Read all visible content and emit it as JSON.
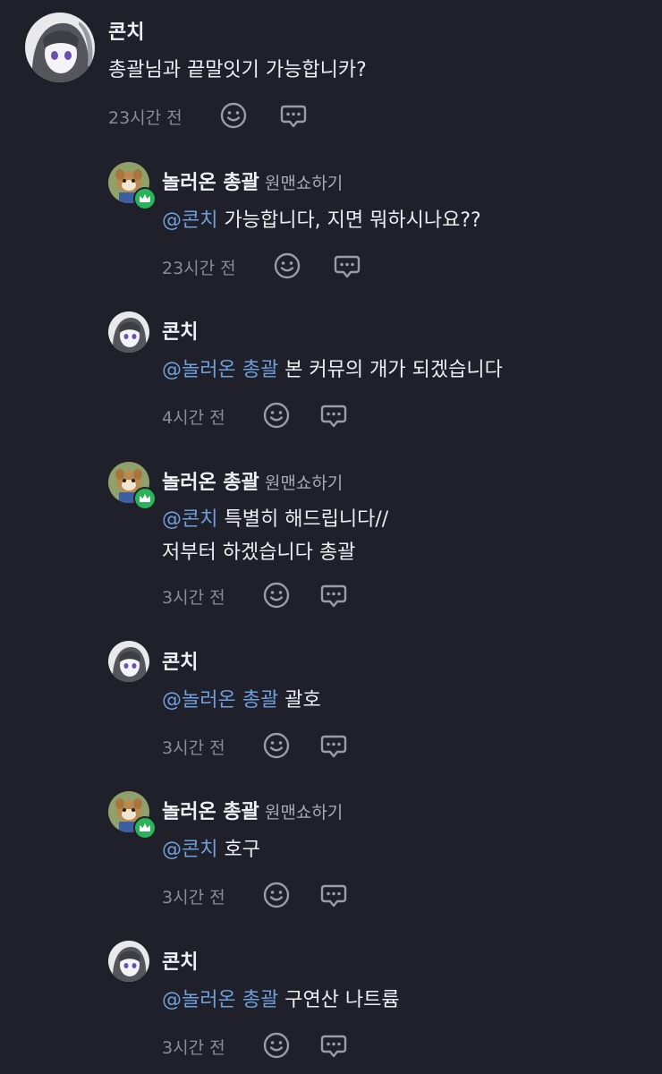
{
  "comments": [
    {
      "author": "콘치",
      "tag": "",
      "mention": "",
      "lines": [
        "총괄님과 끝말잇기 가능합니카?"
      ],
      "time": "23시간 전"
    },
    {
      "author": "놀러온 총괄",
      "tag": "원맨쇼하기",
      "mention": "@콘치",
      "lines": [
        "가능합니다, 지면 뭐하시나요??"
      ],
      "time": "23시간 전"
    },
    {
      "author": "콘치",
      "tag": "",
      "mention": "@놀러온 총괄",
      "lines": [
        "본 커뮤의 개가 되겠습니다"
      ],
      "time": "4시간 전"
    },
    {
      "author": "놀러온 총괄",
      "tag": "원맨쇼하기",
      "mention": "@콘치",
      "lines": [
        "특별히 해드립니다//",
        "저부터 하겠습니다 총괄"
      ],
      "time": "3시간 전"
    },
    {
      "author": "콘치",
      "tag": "",
      "mention": "@놀러온 총괄",
      "lines": [
        "괄호"
      ],
      "time": "3시간 전"
    },
    {
      "author": "놀러온 총괄",
      "tag": "원맨쇼하기",
      "mention": "@콘치",
      "lines": [
        "호구"
      ],
      "time": "3시간 전"
    },
    {
      "author": "콘치",
      "tag": "",
      "mention": "@놀러온 총괄",
      "lines": [
        "구연산 나트륨"
      ],
      "time": "3시간 전"
    }
  ],
  "icons": {
    "reaction": "smiley-icon",
    "reply": "speech-bubble-icon"
  },
  "colors": {
    "background": "#1f2029",
    "mention": "#6f9fdc",
    "badge": "#2bb35a",
    "muted": "#8a8c96"
  }
}
